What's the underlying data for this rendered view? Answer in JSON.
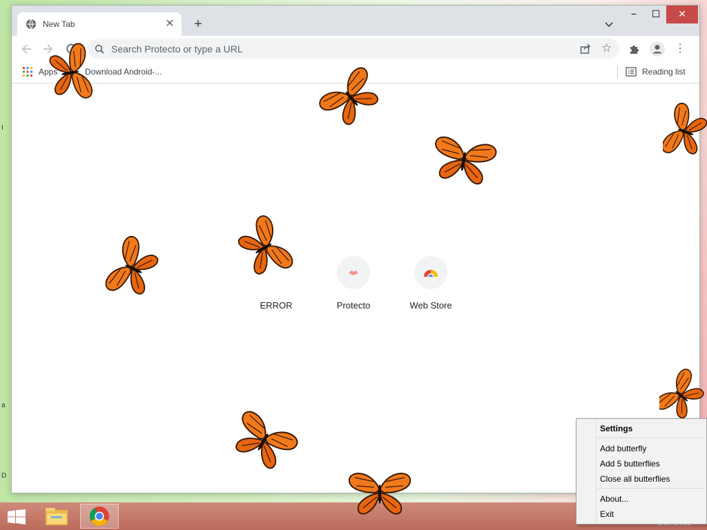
{
  "browser": {
    "tab": {
      "title": "New Tab",
      "close": "✕"
    },
    "new_tab": "+",
    "window_controls": {
      "minimize": "−",
      "maximize": "☐",
      "close": "✕"
    },
    "omnibox": {
      "placeholder": "Search Protecto or type a URL"
    },
    "bookmarks": {
      "apps_label": "Apps",
      "item_label": "Download Android-...",
      "reading_list": "Reading list"
    },
    "shortcuts": [
      {
        "label": "ERROR"
      },
      {
        "label": "Protecto"
      },
      {
        "label": "Web Store"
      }
    ]
  },
  "context_menu": {
    "title": "Settings",
    "items": [
      "Add butterfly",
      "Add 5 butterflies",
      "Close all butterflies",
      "About...",
      "Exit"
    ]
  },
  "taskbar": {
    "clock": "2/20/2022"
  },
  "colors": {
    "tab_strip": "#dee1e6",
    "taskbar": "#c97d6d",
    "butterfly_orange": "#f2791a"
  },
  "icons": [
    "globe-icon",
    "search-icon",
    "share-icon",
    "star-icon",
    "puzzle-icon",
    "profile-icon",
    "kebab-menu-icon",
    "apps-grid-icon",
    "reading-list-icon",
    "windows-start-icon",
    "file-explorer-icon",
    "chrome-icon",
    "butterfly-icon"
  ]
}
